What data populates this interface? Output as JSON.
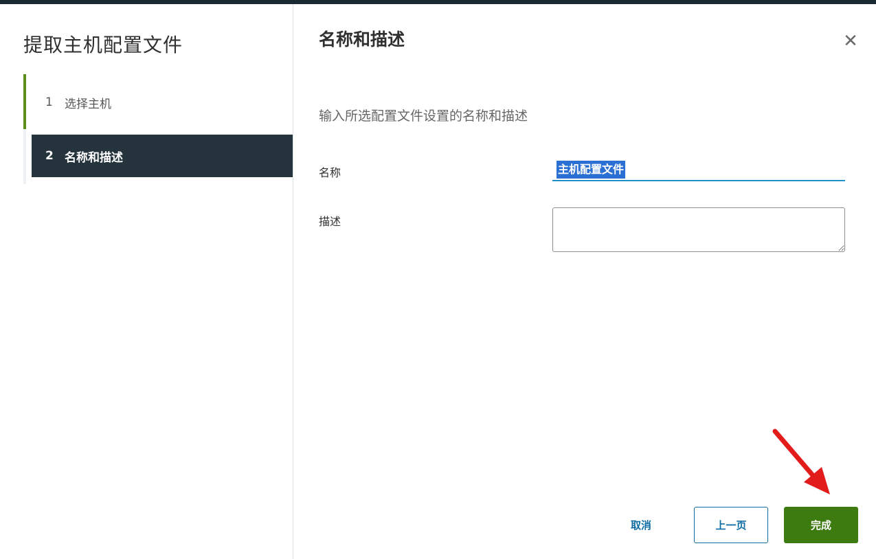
{
  "wizard": {
    "title": "提取主机配置文件",
    "steps": [
      {
        "number": "1",
        "label": "选择主机",
        "state": "completed"
      },
      {
        "number": "2",
        "label": "名称和描述",
        "state": "active"
      }
    ]
  },
  "content": {
    "title": "名称和描述",
    "instruction": "输入所选配置文件设置的名称和描述",
    "close_icon": "close-icon"
  },
  "form": {
    "name_label": "名称",
    "name_value": "主机配置文件",
    "description_label": "描述",
    "description_value": ""
  },
  "footer": {
    "cancel_label": "取消",
    "prev_label": "上一页",
    "finish_label": "完成"
  },
  "colors": {
    "accent_green": "#3d7a0f",
    "nav_active": "#25333d",
    "link_blue": "#0f6da3",
    "annotation_red": "#e21b1b"
  }
}
